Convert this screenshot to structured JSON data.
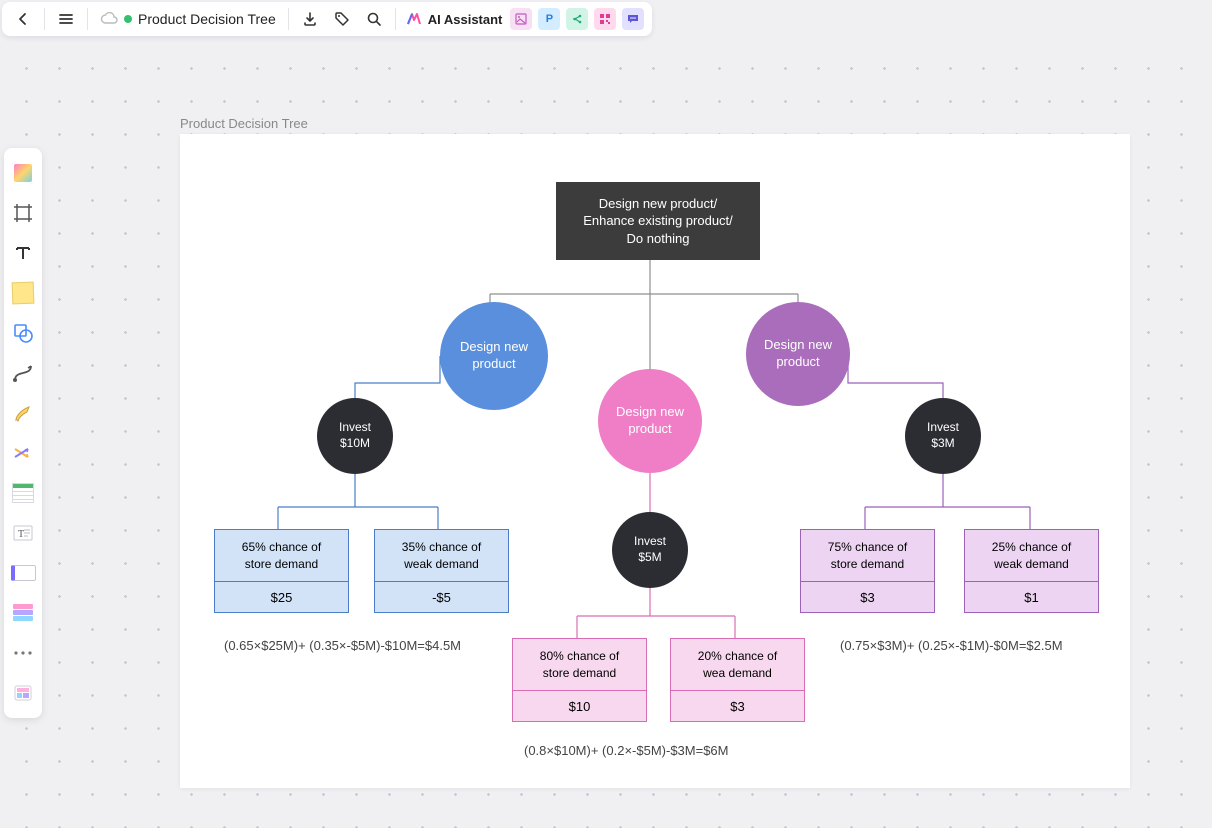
{
  "header": {
    "title": "Product Decision Tree",
    "ai_assistant": "AI Assistant"
  },
  "page": {
    "title": "Product Decision Tree"
  },
  "root": {
    "line1": "Design new product/",
    "line2": "Enhance existing product/",
    "line3": "Do nothing"
  },
  "branches": {
    "a": {
      "label_l1": "Design new",
      "label_l2": "product",
      "color": "#5a8fdd"
    },
    "b": {
      "label_l1": "Design new",
      "label_l2": "product",
      "color": "#ef7ec6"
    },
    "c": {
      "label_l1": "Design new",
      "label_l2": "product",
      "color": "#a96dbb"
    }
  },
  "invest": {
    "a": {
      "line1": "Invest",
      "line2": "$10M"
    },
    "b": {
      "line1": "Invest",
      "line2": "$5M"
    },
    "c": {
      "line1": "Invest",
      "line2": "$3M"
    }
  },
  "outcomes": {
    "a1": {
      "top_l1": "65% chance of",
      "top_l2": "store demand",
      "value": "$25"
    },
    "a2": {
      "top_l1": "35% chance of",
      "top_l2": "weak demand",
      "value": "-$5"
    },
    "b1": {
      "top_l1": "80% chance of",
      "top_l2": "store demand",
      "value": "$10"
    },
    "b2": {
      "top_l1": "20% chance of",
      "top_l2": "wea demand",
      "value": "$3"
    },
    "c1": {
      "top_l1": "75% chance of",
      "top_l2": "store demand",
      "value": "$3"
    },
    "c2": {
      "top_l1": "25% chance of",
      "top_l2": "weak demand",
      "value": "$1"
    }
  },
  "formulas": {
    "a": "(0.65×$25M)+  (0.35×-$5M)-$10M=$4.5M",
    "b": "(0.8×$10M)+  (0.2×-$5M)-$3M=$6M",
    "c": "(0.75×$3M)+  (0.25×-$1M)-$0M=$2.5M"
  },
  "icons": {
    "chipP": "P"
  }
}
